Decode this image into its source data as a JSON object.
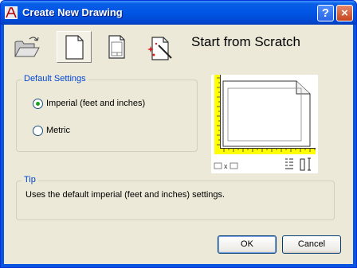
{
  "window": {
    "title": "Create New Drawing",
    "help_label": "?",
    "close_label": "×"
  },
  "toolbar": {
    "heading": "Start from Scratch",
    "tools": [
      {
        "name": "open-drawing",
        "icon": "folder-open-icon"
      },
      {
        "name": "start-from-scratch",
        "icon": "blank-page-icon",
        "active": true
      },
      {
        "name": "use-template",
        "icon": "template-page-icon"
      },
      {
        "name": "use-wizard",
        "icon": "wizard-icon"
      }
    ]
  },
  "default_settings": {
    "legend": "Default Settings",
    "options": [
      {
        "label": "Imperial (feet and inches)",
        "checked": true
      },
      {
        "label": "Metric",
        "checked": false
      }
    ]
  },
  "preview": {
    "ruler_color": "#ffff00",
    "x_label": "x"
  },
  "tip": {
    "legend": "Tip",
    "text": "Uses the default imperial (feet and inches) settings."
  },
  "buttons": {
    "ok": "OK",
    "cancel": "Cancel"
  }
}
